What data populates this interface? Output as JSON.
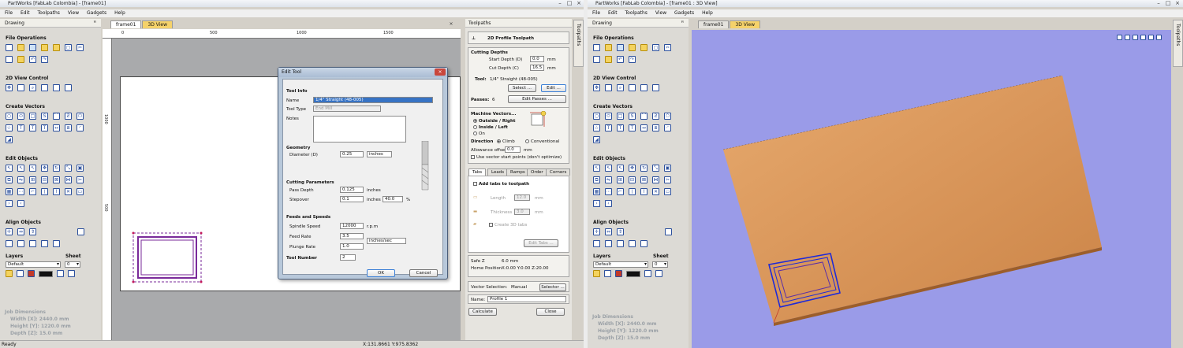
{
  "left": {
    "title": "PartWorks [FabLab Colombia] - [frame01]",
    "menu": [
      "File",
      "Edit",
      "Toolpaths",
      "View",
      "Gadgets",
      "Help"
    ],
    "drawing_panel": {
      "title": "Drawing",
      "sections": {
        "file_ops": "File Operations",
        "view_control": "2D View Control",
        "create_vectors": "Create Vectors",
        "edit_objects": "Edit Objects",
        "align_objects": "Align Objects"
      },
      "layers_label": "Layers",
      "sheet_label": "Sheet",
      "layer_value": "Default",
      "sheet_value": "0",
      "job": {
        "heading": "Job Dimensions",
        "width": "Width  [X]: 2440.0 mm",
        "height": "Height [Y]: 1220.0 mm",
        "depth": "Depth  [Z]: 15.0 mm"
      }
    },
    "doc_tabs": [
      "frame01",
      "3D View"
    ],
    "ruler": {
      "top": [
        "0",
        "500",
        "1000",
        "1500"
      ],
      "left": [
        "1000",
        "500"
      ]
    },
    "edit_tool": {
      "title": "Edit Tool",
      "tool_info": "Tool Info",
      "name_label": "Name",
      "name_value": "1/4\" Straight (48-005)",
      "type_label": "Tool Type",
      "type_value": "End Mill",
      "notes_label": "Notes",
      "geometry": "Geometry",
      "diameter_label": "Diameter (D)",
      "diameter_value": "0.25",
      "diameter_unit": "inches",
      "cutting_params": "Cutting Parameters",
      "pass_depth_label": "Pass Depth",
      "pass_depth_value": "0.125",
      "pass_depth_unit": "inches",
      "stepover_label": "Stepover",
      "stepover_value": "0.1",
      "stepover_unit": "inches",
      "stepover_pct": "40.0",
      "pct_sign": "%",
      "feeds_speeds": "Feeds and Speeds",
      "spindle_label": "Spindle Speed",
      "spindle_value": "12000",
      "spindle_unit": "r.p.m",
      "feed_label": "Feed Rate",
      "feed_value": "3.5",
      "feed_unit": "inches/sec",
      "plunge_label": "Plunge Rate",
      "plunge_value": "1.0",
      "tool_number_label": "Tool Number",
      "tool_number_value": "2",
      "ok": "OK",
      "cancel": "Cancel"
    },
    "toolpaths": {
      "panel_title": "Toolpaths",
      "header": "2D Profile Toolpath",
      "cutting_depths": "Cutting Depths",
      "start_depth_label": "Start Depth (D)",
      "start_depth_value": "0.0",
      "cut_depth_label": "Cut Depth (C)",
      "cut_depth_value": "16.5",
      "mm": "mm",
      "tool_label": "Tool:",
      "tool_value": "1/4\" Straight (48-005)",
      "select_btn": "Select ...",
      "edit_btn": "Edit ...",
      "passes_label": "Passes:",
      "passes_value": "6",
      "edit_passes_btn": "Edit Passes ...",
      "machine_vectors": "Machine Vectors...",
      "outside": "Outside / Right",
      "inside": "Inside / Left",
      "on": "On",
      "direction": "Direction",
      "climb": "Climb",
      "conventional": "Conventional",
      "allowance_label": "Allowance offset",
      "allowance_value": "0.0",
      "start_points": "Use vector start points (don't optimize)",
      "tabs": [
        "Tabs",
        "Leads",
        "Ramps",
        "Order",
        "Corners"
      ],
      "add_tabs": "Add tabs to toolpath",
      "length_label": "Length",
      "length_value": "12.0",
      "thickness_label": "Thickness",
      "thickness_value": "3.0",
      "create_3d_tabs": "Create 3D tabs",
      "edit_tabs_btn": "Edit Tabs ...",
      "safe_z_label": "Safe Z",
      "safe_z_value": "6.0 mm",
      "home_label": "Home Position",
      "home_value": "X:0.00 Y:0.00 Z:20.00",
      "vector_sel_label": "Vector Selection:",
      "vector_sel_value": "Manual",
      "selector_btn": "Selector ...",
      "name_label": "Name:",
      "name_value": "Profile 1",
      "calculate": "Calculate",
      "close": "Close"
    },
    "side_tab": "Toolpaths",
    "status_left": "Ready",
    "status_coords": "X:131.8661 Y:975.8362"
  },
  "right": {
    "title": "PartWorks [FabLab Colombia] - [frame01 : 3D View]",
    "menu": [
      "File",
      "Edit",
      "Toolpaths",
      "View",
      "Gadgets",
      "Help"
    ],
    "panel_title": "Drawing",
    "sections": {
      "file_ops": "File Operations",
      "view_control": "2D View Control",
      "create_vectors": "Create Vectors",
      "edit_objects": "Edit Objects",
      "align_objects": "Align Objects"
    },
    "layers_label": "Layers",
    "sheet_label": "Sheet",
    "layer_value": "Default",
    "sheet_value": "0",
    "job": {
      "heading": "Job Dimensions",
      "width": "Width  [X]: 2440.0 mm",
      "height": "Height [Y]: 1220.0 mm",
      "depth": "Depth  [Z]: 15.0 mm"
    },
    "doc_tabs": [
      "frame01",
      "3D View"
    ],
    "side_tab": "Toolpaths"
  },
  "colors": {
    "wood": "#d9965a",
    "view3d_bg": "#9a9be8",
    "toolpath_blue": "#1e2ad8",
    "vector_purple": "#7a2a9a",
    "dialog_frame": "#b8c8da"
  }
}
